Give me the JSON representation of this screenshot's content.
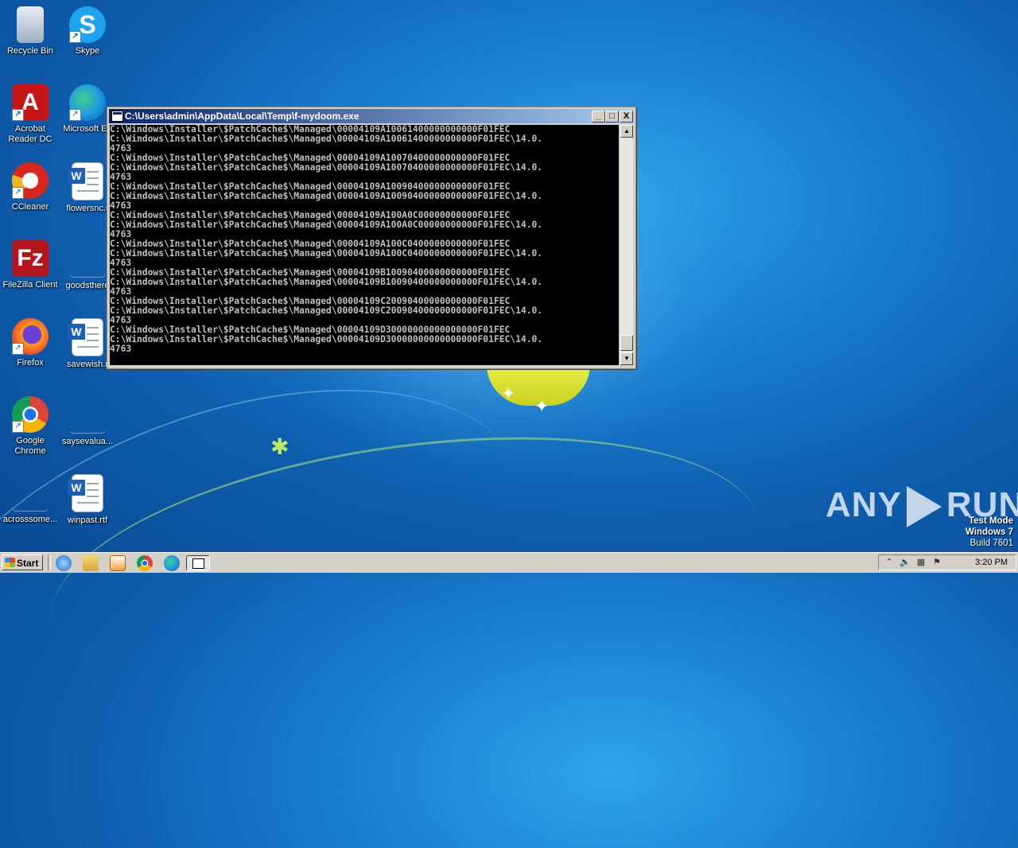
{
  "desktop": {
    "icons": [
      {
        "label": "Recycle Bin",
        "icon": "recycle-bin-icon"
      },
      {
        "label": "Skype",
        "icon": "skype-icon"
      },
      {
        "label": "Acrobat Reader DC",
        "icon": "acrobat-icon"
      },
      {
        "label": "Microsoft Ed",
        "icon": "edge-icon"
      },
      {
        "label": "CCleaner",
        "icon": "ccleaner-icon"
      },
      {
        "label": "flowersnc.r",
        "icon": "word-doc-icon"
      },
      {
        "label": "FileZilla Client",
        "icon": "filezilla-icon"
      },
      {
        "label": "goodsthere",
        "icon": "file-icon"
      },
      {
        "label": "Firefox",
        "icon": "firefox-icon"
      },
      {
        "label": "savewish.r",
        "icon": "word-doc-icon"
      },
      {
        "label": "Google Chrome",
        "icon": "chrome-icon"
      },
      {
        "label": "saysevalua...",
        "icon": "file-icon"
      },
      {
        "label": "acrosssome...",
        "icon": "file-icon"
      },
      {
        "label": "winpast.rtf",
        "icon": "word-doc-icon"
      }
    ]
  },
  "console_window": {
    "title": "C:\\Users\\admin\\AppData\\Local\\Temp\\f-mydoom.exe",
    "buttons": {
      "minimize": "_",
      "maximize": "□",
      "close": "X"
    },
    "output": "C:\\Windows\\Installer\\$PatchCache$\\Managed\\00004109A10061400000000000F01FEC\nC:\\Windows\\Installer\\$PatchCache$\\Managed\\00004109A10061400000000000F01FEC\\14.0.\n4763\nC:\\Windows\\Installer\\$PatchCache$\\Managed\\00004109A10070400000000000F01FEC\nC:\\Windows\\Installer\\$PatchCache$\\Managed\\00004109A10070400000000000F01FEC\\14.0.\n4763\nC:\\Windows\\Installer\\$PatchCache$\\Managed\\00004109A10090400000000000F01FEC\nC:\\Windows\\Installer\\$PatchCache$\\Managed\\00004109A10090400000000000F01FEC\\14.0.\n4763\nC:\\Windows\\Installer\\$PatchCache$\\Managed\\00004109A100A0C00000000000F01FEC\nC:\\Windows\\Installer\\$PatchCache$\\Managed\\00004109A100A0C00000000000F01FEC\\14.0.\n4763\nC:\\Windows\\Installer\\$PatchCache$\\Managed\\00004109A100C0400000000000F01FEC\nC:\\Windows\\Installer\\$PatchCache$\\Managed\\00004109A100C0400000000000F01FEC\\14.0.\n4763\nC:\\Windows\\Installer\\$PatchCache$\\Managed\\00004109B10090400000000000F01FEC\nC:\\Windows\\Installer\\$PatchCache$\\Managed\\00004109B10090400000000000F01FEC\\14.0.\n4763\nC:\\Windows\\Installer\\$PatchCache$\\Managed\\00004109C20090400000000000F01FEC\nC:\\Windows\\Installer\\$PatchCache$\\Managed\\00004109C20090400000000000F01FEC\\14.0.\n4763\nC:\\Windows\\Installer\\$PatchCache$\\Managed\\00004109D30000000000000000F01FEC\nC:\\Windows\\Installer\\$PatchCache$\\Managed\\00004109D30000000000000000F01FEC\\14.0.\n4763"
  },
  "watermark": {
    "left": "ANY",
    "right": "RUN"
  },
  "test_mode": {
    "line1": "Test Mode",
    "line2": "Windows 7",
    "line3": "Build 7601"
  },
  "taskbar": {
    "start_label": "Start",
    "clock": "3:20 PM",
    "quick_launch": [
      "ie-icon",
      "explorer-icon",
      "media-player-icon",
      "chrome-icon",
      "edge-icon",
      "console-icon"
    ]
  }
}
